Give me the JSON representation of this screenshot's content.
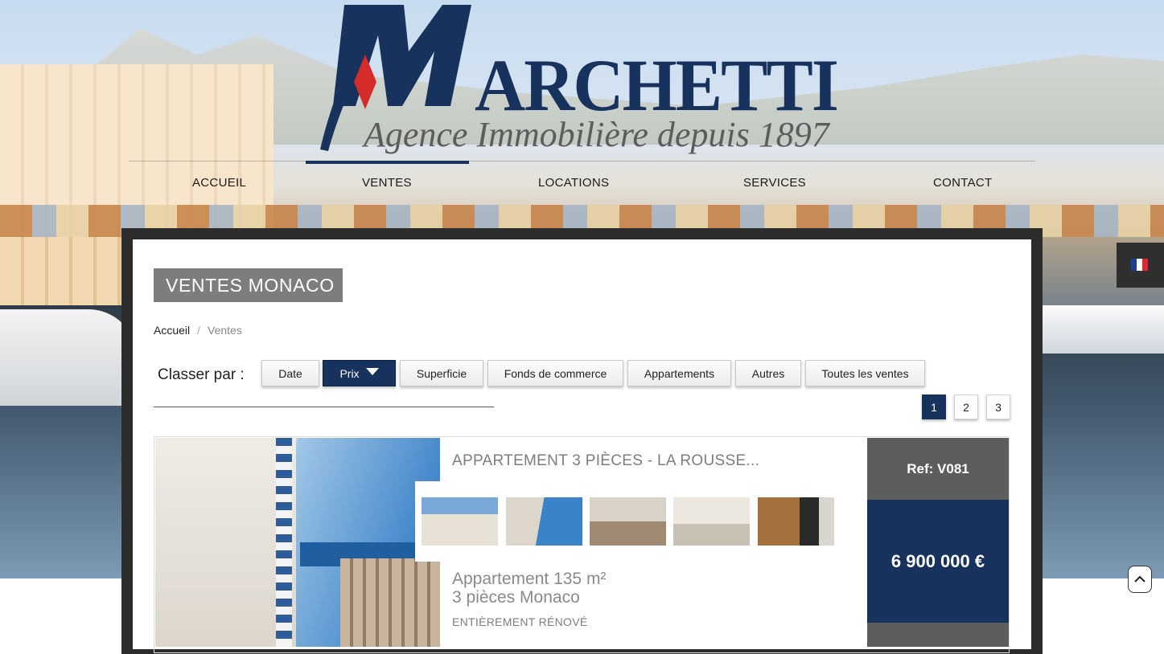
{
  "logo": {
    "name": "ARCHETTI",
    "tagline": "Agence Immobilière depuis 1897"
  },
  "nav": {
    "items": [
      {
        "label": "ACCUEIL"
      },
      {
        "label": "VENTES",
        "active": true
      },
      {
        "label": "LOCATIONS"
      },
      {
        "label": "SERVICES"
      },
      {
        "label": "CONTACT"
      }
    ]
  },
  "language": {
    "current": "fr",
    "icon": "french-flag-icon"
  },
  "page": {
    "title": "VENTES MONACO",
    "breadcrumb": [
      {
        "label": "Accueil"
      },
      {
        "label": "Ventes"
      }
    ]
  },
  "sort": {
    "label": "Classer par :",
    "buttons": [
      {
        "label": "Date"
      },
      {
        "label": "Prix",
        "active": true
      },
      {
        "label": "Superficie"
      },
      {
        "label": "Fonds de commerce"
      },
      {
        "label": "Appartements"
      },
      {
        "label": "Autres"
      },
      {
        "label": "Toutes les ventes"
      }
    ]
  },
  "pagination": {
    "pages": [
      "1",
      "2",
      "3"
    ],
    "current": "1"
  },
  "listing": {
    "title": "APPARTEMENT 3 PIÈCES - LA ROUSSE...",
    "subtitle_line1": "Appartement 135 m²",
    "subtitle_line2": "3 pièces Monaco",
    "note": "ENTIÈREMENT RÉNOVÉ",
    "ref": "Ref: V081",
    "price": "6 900 000 €",
    "thumbnail_count": 5
  },
  "colors": {
    "brand_navy": "#17325c",
    "brand_red": "#d42b2b",
    "grey_box": "#5d5d5d",
    "title_box": "#7d7d7d"
  }
}
